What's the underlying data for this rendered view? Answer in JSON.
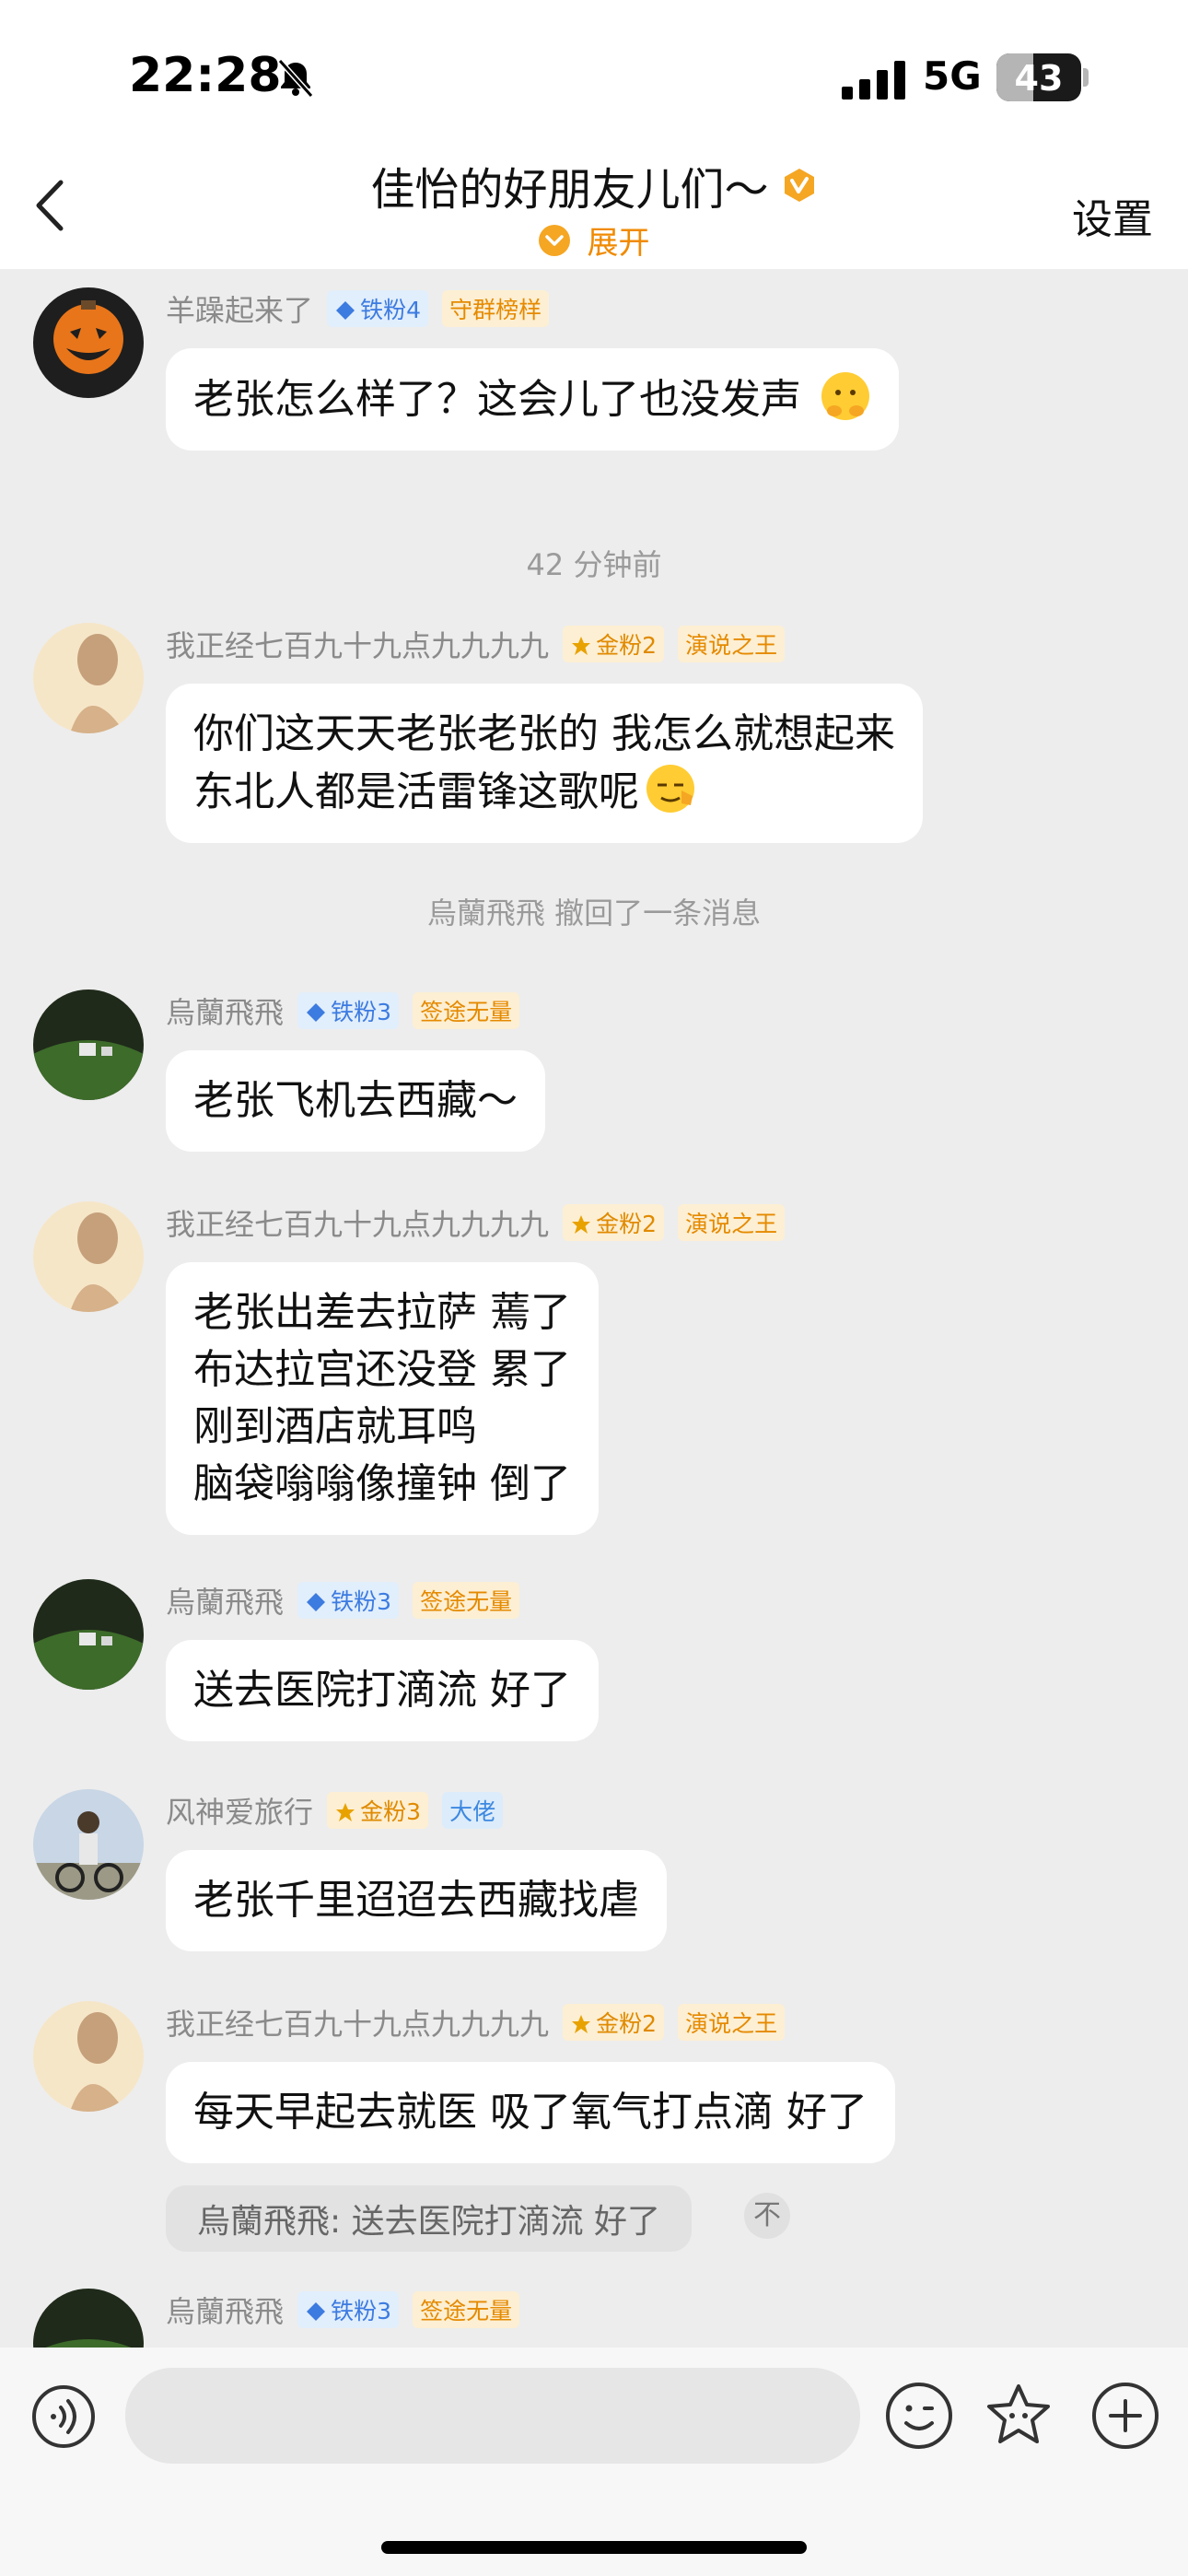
{
  "status_bar": {
    "time": "22:28",
    "network": "5G",
    "battery": "43",
    "battery_level": 0.43
  },
  "header": {
    "back_label": "",
    "title": "佳怡的好朋友儿们～",
    "expand_label": "展开",
    "settings_label": "设置"
  },
  "messages": [
    {
      "nick": "羊躁起来了",
      "fan_badge": "铁粉4",
      "title_badge": "守群榜样",
      "lines": [
        "老张怎么样了？这会儿了也没发声"
      ]
    },
    {
      "nick": "我正经七百九十九点九九九九",
      "fan_badge": "金粉2",
      "title_badge": "演说之王",
      "lines": [
        "你们这天天老张老张的 我怎么就想起来",
        "东北人都是活雷锋这歌呢"
      ]
    },
    {
      "nick": "烏蘭飛飛",
      "fan_badge": "铁粉3",
      "title_badge": "签途无量",
      "lines": [
        "老张飞机去西藏～"
      ]
    },
    {
      "nick": "我正经七百九十九点九九九九",
      "fan_badge": "金粉2",
      "title_badge": "演说之王",
      "lines": [
        "老张出差去拉萨 蔫了",
        "布达拉宫还没登 累了",
        "刚到酒店就耳鸣",
        "脑袋嗡嗡像撞钟 倒了"
      ]
    },
    {
      "nick": "烏蘭飛飛",
      "fan_badge": "铁粉3",
      "title_badge": "签途无量",
      "lines": [
        "送去医院打滴流  好了"
      ]
    },
    {
      "nick": "风神爱旅行",
      "fan_badge": "金粉3",
      "title_badge": "大佬",
      "lines": [
        "老张千里迢迢去西藏找虐"
      ]
    },
    {
      "nick": "我正经七百九十九点九九九九",
      "fan_badge": "金粉2",
      "title_badge": "演说之王",
      "lines": [
        "每天早起去就医 吸了氧气打点滴 好了"
      ]
    },
    {
      "nick": "烏蘭飛飛",
      "fan_badge": "铁粉3",
      "title_badge": "签途无量",
      "lines": []
    }
  ],
  "system": {
    "time_divider": "42 分钟前",
    "recall_notice": "烏蘭飛飛 撤回了一条消息"
  },
  "quote": {
    "text": "烏蘭飛飛: 送去医院打滴流  好了",
    "button": "不"
  },
  "composer": {
    "placeholder": ""
  },
  "colors": {
    "accent": "#f08a00",
    "iron_badge": "#3c7be0",
    "gold_badge": "#e08a00",
    "background": "#ededed"
  }
}
